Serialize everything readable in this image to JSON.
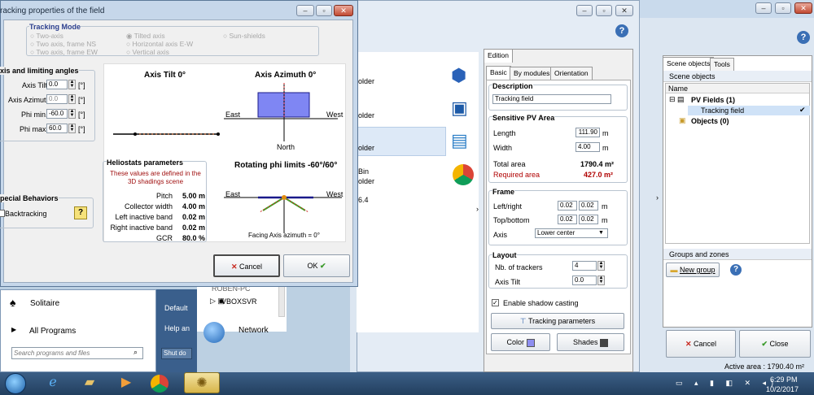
{
  "dialog": {
    "title": "racking properties of the field",
    "tracking_mode_label": "Tracking Mode",
    "modes": [
      "Two-axis",
      "Two axis, frame NS",
      "Two axis, frame EW",
      "Tilted axis",
      "Horizontal axis E-W",
      "Vertical axis",
      "Sun-shields"
    ],
    "axis_group_label": "xis and limiting angles",
    "axis_tilt_label": "Axis Tilt",
    "axis_tilt_value": "0.0",
    "axis_azimuth_label": "Axis Azimuth",
    "axis_azimuth_value": "0.0",
    "phi_min_label": "Phi min.",
    "phi_min_value": "-60.0",
    "phi_max_label": "Phi max.",
    "phi_max_value": "60.0",
    "deg_unit": "[°]",
    "diagram_tilt_title": "Axis Tilt 0°",
    "diagram_azimuth_title": "Axis Azimuth 0°",
    "east": "East",
    "west": "West",
    "north": "North",
    "helio_title": "Heliostats parameters",
    "helio_note": "These values are defined in the 3D shadings scene",
    "helio_rows": [
      {
        "label": "Pitch",
        "value": "5.00 m"
      },
      {
        "label": "Collector width",
        "value": "4.00 m"
      },
      {
        "label": "Left inactive band",
        "value": "0.02 m"
      },
      {
        "label": "Right inactive band",
        "value": "0.02 m"
      },
      {
        "label": "GCR",
        "value": "80.0 %"
      }
    ],
    "rotating_title": "Rotating phi limits -60°/60°",
    "facing_note": "Facing Axis azimuth = 0°",
    "special_label": "pecial Behaviors",
    "backtracking_label": "Backtracking",
    "help_glyph": "?",
    "cancel_label": "Cancel",
    "ok_label": "OK"
  },
  "edition": {
    "tab_label": "Edition",
    "tabs": [
      "Basic",
      "By modules",
      "Orientation"
    ],
    "description_label": "Description",
    "description_value": "Tracking field",
    "pv_area_label": "Sensitive PV Area",
    "length_label": "Length",
    "length_value": "111.90",
    "width_label": "Width",
    "width_value": "4.00",
    "m": "m",
    "total_area_label": "Total area",
    "total_area_value": "1790.4 m²",
    "required_area_label": "Required area",
    "required_area_value": "427.0 m²",
    "frame_label": "Frame",
    "left_right_label": "Left/right",
    "lr1": "0.02",
    "lr2": "0.02",
    "top_bottom_label": "Top/bottom",
    "tb1": "0.02",
    "tb2": "0.02",
    "axis_label": "Axis",
    "axis_value": "Lower center",
    "layout_label": "Layout",
    "nb_trackers_label": "Nb. of trackers",
    "nb_trackers_value": "4",
    "layout_tilt_label": "Axis Tilt",
    "layout_tilt_value": "0.0",
    "shadow_label": "Enable shadow casting",
    "tracking_params_label": "Tracking parameters",
    "color_label": "Color",
    "shades_label": "Shades"
  },
  "scene": {
    "tab_objects": "Scene objects",
    "tab_tools": "Tools",
    "header": "Scene objects",
    "col_name": "Name",
    "pv_fields": "PV Fields (1)",
    "tracking_field": "Tracking field",
    "objects": "Objects (0)",
    "groups_header": "Groups and zones",
    "new_group": "New group",
    "cancel_label": "Cancel",
    "close_label": "Close",
    "active_area": "Active area : 1790.40 m²"
  },
  "background": {
    "folder_texts": [
      "older",
      "older",
      "older"
    ],
    "bin_text": "Bin",
    "bin_sub": "older",
    "version": "6.4",
    "robin": "ROBEN-PC",
    "vboxsvr": "VBOXSVR",
    "network": "Network"
  },
  "startmenu": {
    "solitaire": "Solitaire",
    "all_programs": "All Programs",
    "search_placeholder": "Search programs and files",
    "default": "Default",
    "help": "Help an",
    "shutdown": "Shut do"
  },
  "taskbar": {
    "time": "6:29 PM",
    "date": "10/2/2017"
  }
}
